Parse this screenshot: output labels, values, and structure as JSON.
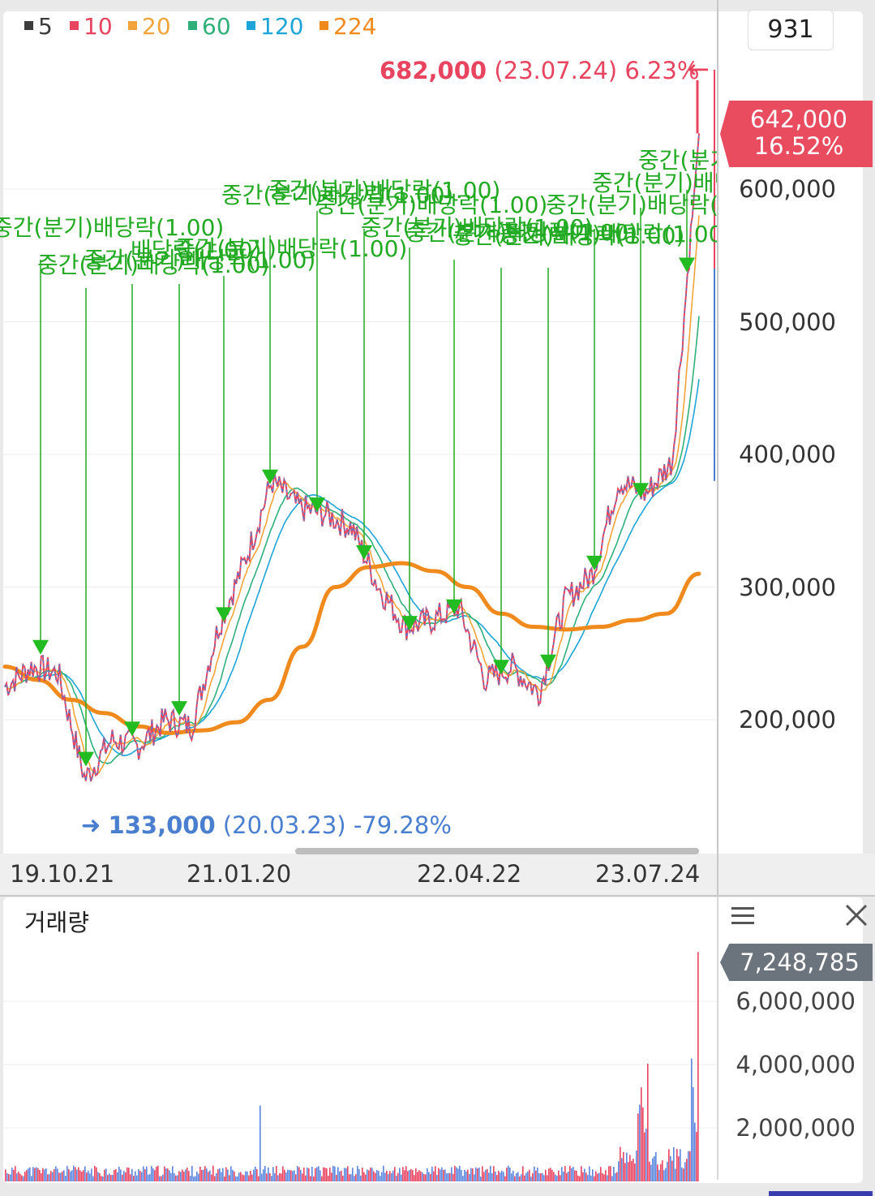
{
  "legend": [
    {
      "label": "5",
      "color": "#3c3c3c"
    },
    {
      "label": "10",
      "color": "#e8435f"
    },
    {
      "label": "20",
      "color": "#f2a43a"
    },
    {
      "label": "60",
      "color": "#2fb07a"
    },
    {
      "label": "120",
      "color": "#1ea5d8"
    },
    {
      "label": "224",
      "color": "#f08a1c"
    }
  ],
  "period_box": "931",
  "high_marker": {
    "price": "682,000",
    "date": "(23.07.24)",
    "pct": "6.23%",
    "arrow": "←"
  },
  "low_marker": {
    "arrow": "➜",
    "price": "133,000",
    "date": "(20.03.23)",
    "pct": "-79.28%"
  },
  "current_price": {
    "price": "642,000",
    "pct": "16.52%"
  },
  "y_ticks": [
    "600,000",
    "500,000",
    "400,000",
    "300,000",
    "200,000"
  ],
  "x_ticks": [
    "19.10.21",
    "21.01.20",
    "22.04.22",
    "23.07.24"
  ],
  "volume_panel": {
    "title": "거래량",
    "current": "7,248,785",
    "y_ticks": [
      "6,000,000",
      "4,000,000",
      "2,000,000"
    ],
    "menu_icon": "menu-icon",
    "close_icon": "close-icon"
  },
  "dividend_label": "중간(분기)배당락(1.00)",
  "dividend_label_short": "배당락(1.00)",
  "chart_data": {
    "type": "line",
    "title": "",
    "price_axis": {
      "ylim": [
        100000,
        650000
      ],
      "ticks": [
        200000,
        300000,
        400000,
        500000,
        600000
      ]
    },
    "x_ticks": [
      "19.10.21",
      "21.01.20",
      "22.04.22",
      "23.07.24"
    ],
    "series": [
      {
        "name": "5",
        "values": [
          225000,
          240000,
          235000,
          155000,
          185000,
          180000,
          200000,
          195000,
          270000,
          320000,
          380000,
          360000,
          355000,
          345000,
          300000,
          270000,
          275000,
          285000,
          230000,
          240000,
          220000,
          290000,
          310000,
          380000,
          370000,
          395000,
          642000
        ]
      },
      {
        "name": "224",
        "values": [
          240000,
          230000,
          215000,
          205000,
          195000,
          190000,
          192000,
          198000,
          215000,
          255000,
          300000,
          315000,
          318000,
          312000,
          300000,
          280000,
          270000,
          268000,
          270000,
          275000,
          280000,
          310000
        ]
      }
    ],
    "high": {
      "value": 682000,
      "date": "23.07.24",
      "pct": 6.23
    },
    "low": {
      "value": 133000,
      "date": "20.03.23",
      "pct": -79.28
    },
    "current": {
      "value": 642000,
      "pct": 16.52
    },
    "volume": {
      "ylim": [
        0,
        8000000
      ],
      "ticks": [
        2000000,
        4000000,
        6000000
      ],
      "current": 7248785
    },
    "legend_position": "top-left",
    "grid": true
  }
}
